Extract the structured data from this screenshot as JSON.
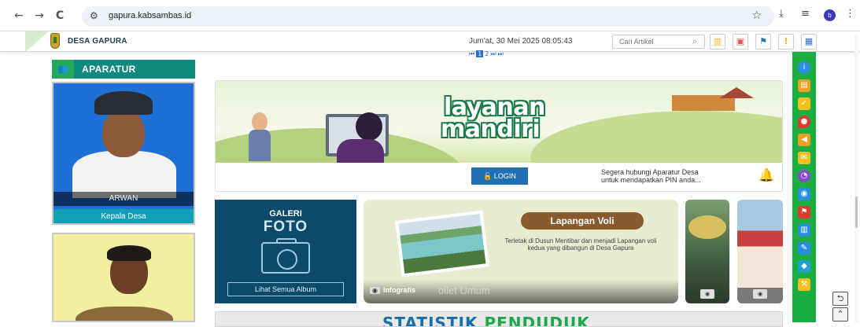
{
  "browser": {
    "back_icon": "arrow-left-icon",
    "back": "←",
    "forward": "→",
    "reload": "C",
    "site_settings": "⚙",
    "url": "gapura.kabsambas.id",
    "star": "☆",
    "download": "⤓",
    "menu": "⋮",
    "profile": "b"
  },
  "header": {
    "site_name": "DESA GAPURA",
    "datetime": "Jum'at, 30 Mei 2025  08:05:43",
    "search_placeholder": "Cari Artikel",
    "search_icon": "🔍",
    "buttons": [
      {
        "icon": "bar-chart-icon",
        "glyph": "▥",
        "color": "#f0b623"
      },
      {
        "icon": "lock-icon",
        "glyph": "🔒",
        "color": "#d9534f"
      },
      {
        "icon": "map-icon",
        "glyph": "⚑",
        "color": "#2a6fcf"
      },
      {
        "icon": "exclamation-icon",
        "glyph": "!",
        "color": "#f0b623"
      },
      {
        "icon": "grid-icon",
        "glyph": "▦",
        "color": "#2a6fcf"
      }
    ]
  },
  "aparatur": {
    "title": "APARATUR",
    "title_icon": "users-icon",
    "members": [
      {
        "name": "ARWAN",
        "role": "Kepala Desa"
      }
    ]
  },
  "pager": [
    "⏮",
    "1",
    "2",
    "⏭",
    "⏭"
  ],
  "banner": {
    "title_line1": "layanan",
    "title_line2": "mandiri",
    "login_label": "LOGIN",
    "pin_line1": "Segera hubungi Aparatur Desa",
    "pin_line2": "untuk mendapatkan PIN anda...",
    "bell": "🔔"
  },
  "galeri": {
    "line1": "GALERI",
    "line2": "FOTO",
    "button": "Lihat Semua Album"
  },
  "infografis": {
    "badge_title": "Lapangan Voli",
    "description": "Terletak di Dusun Mentibar dan menjadi Lapangan voli kedua yang dibangun di Desa Gapura",
    "label": "Infografis",
    "ghost_text": "oilet Umum",
    "camera_glyph": "◉"
  },
  "statistik": {
    "part1": "STATISTIK ",
    "part2": "PENDUDUK"
  },
  "rightbar": [
    {
      "icon": "info-icon",
      "color": "#2a8fe0",
      "glyph": "i"
    },
    {
      "icon": "chart-icon",
      "color": "#f0a020",
      "glyph": "▤"
    },
    {
      "icon": "checklist-icon",
      "color": "#f0c020",
      "glyph": "✓"
    },
    {
      "icon": "location-pin-icon",
      "color": "#e03a2a",
      "glyph": "●"
    },
    {
      "icon": "megaphone-icon",
      "color": "#f0a020",
      "glyph": "◀"
    },
    {
      "icon": "mail-icon",
      "color": "#f0c020",
      "glyph": "✉"
    },
    {
      "icon": "pie-chart-icon",
      "color": "#8a4ad0",
      "glyph": "◔"
    },
    {
      "icon": "camera-icon",
      "color": "#2a8fe0",
      "glyph": "◉"
    },
    {
      "icon": "flag-icon",
      "color": "#e03a2a",
      "glyph": "⚑"
    },
    {
      "icon": "stats-icon",
      "color": "#2a8fe0",
      "glyph": "▥"
    },
    {
      "icon": "pencil-icon",
      "color": "#2a8fe0",
      "glyph": "✎"
    },
    {
      "icon": "cube-icon",
      "color": "#20a0d0",
      "glyph": "◆"
    },
    {
      "icon": "gavel-icon",
      "color": "#f0c020",
      "glyph": "⚒"
    }
  ],
  "corner": {
    "back_glyph": "⮌",
    "up_glyph": "⌃"
  }
}
